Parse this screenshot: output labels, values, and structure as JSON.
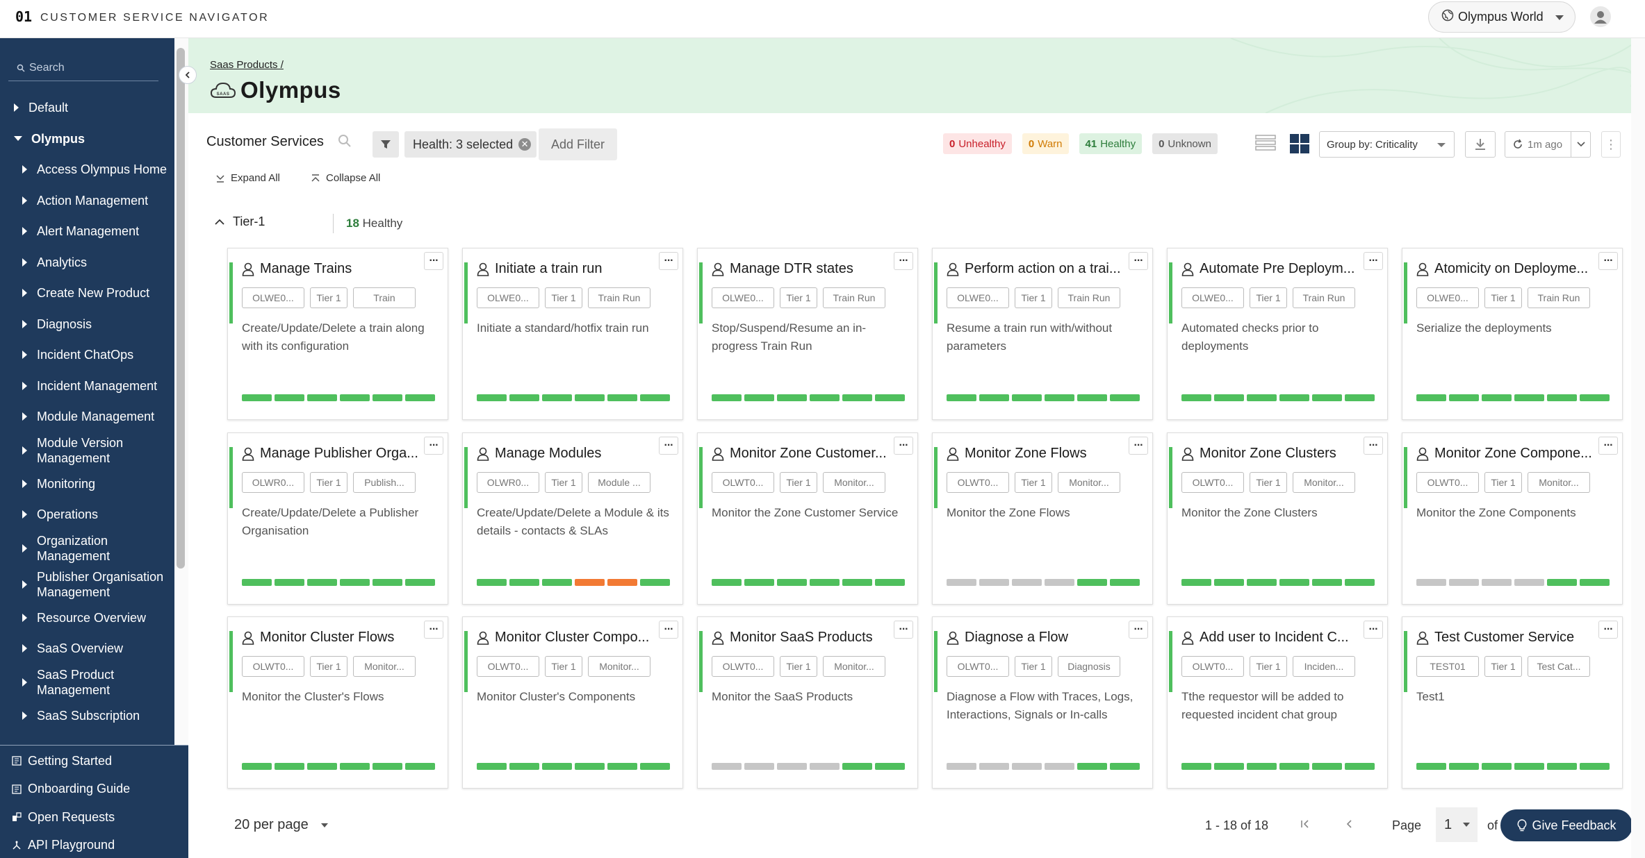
{
  "header": {
    "logo": "01",
    "app_title": "CUSTOMER SERVICE NAVIGATOR",
    "world_select": "Olympus World"
  },
  "sidebar": {
    "search_placeholder": "Search",
    "items": [
      {
        "label": "Default",
        "level": 0,
        "open": false
      },
      {
        "label": "Olympus",
        "level": 0,
        "open": true
      },
      {
        "label": "Access Olympus Home",
        "level": 1
      },
      {
        "label": "Action Management",
        "level": 1
      },
      {
        "label": "Alert Management",
        "level": 1
      },
      {
        "label": "Analytics",
        "level": 1
      },
      {
        "label": "Create New Product",
        "level": 1
      },
      {
        "label": "Diagnosis",
        "level": 1
      },
      {
        "label": "Incident ChatOps",
        "level": 1
      },
      {
        "label": "Incident Management",
        "level": 1
      },
      {
        "label": "Module Management",
        "level": 1
      },
      {
        "label": "Module Version Management",
        "level": 1
      },
      {
        "label": "Monitoring",
        "level": 1
      },
      {
        "label": "Operations",
        "level": 1
      },
      {
        "label": "Organization Management",
        "level": 1
      },
      {
        "label": "Publisher Organisation Management",
        "level": 1
      },
      {
        "label": "Resource Overview",
        "level": 1
      },
      {
        "label": "SaaS Overview",
        "level": 1
      },
      {
        "label": "SaaS Product Management",
        "level": 1
      },
      {
        "label": "SaaS Subscription",
        "level": 1
      }
    ],
    "bottom_links": [
      {
        "label": "Getting Started",
        "icon": "book-icon"
      },
      {
        "label": "Onboarding Guide",
        "icon": "book-icon"
      },
      {
        "label": "Open Requests",
        "icon": "requests-icon"
      },
      {
        "label": "API Playground",
        "icon": "playground-icon"
      }
    ]
  },
  "page": {
    "breadcrumb": "Saas Products /",
    "title": "Olympus",
    "cloud_icon_text": "SAAS"
  },
  "toolbar": {
    "label": "Customer Services",
    "health_filter": "Health: 3 selected",
    "add_filter": "Add Filter",
    "status": {
      "unhealthy_count": "0",
      "unhealthy_label": "Unhealthy",
      "warn_count": "0",
      "warn_label": "Warn",
      "healthy_count": "41",
      "healthy_label": "Healthy",
      "unknown_count": "0",
      "unknown_label": "Unknown"
    },
    "group_by": "Group by: Criticality",
    "refresh_ago": "1m ago",
    "expand_all": "Expand All",
    "collapse_all": "Collapse All"
  },
  "group": {
    "name": "Tier-1",
    "count": "18",
    "count_label": "Healthy"
  },
  "colors": {
    "sidebar": "#1f3a5c",
    "healthy": "#4fbf5d",
    "warn": "#f27a34",
    "unknown": "#c6c6c6",
    "banner": "#dff3e4"
  },
  "cards": [
    {
      "title": "Manage Trains",
      "tags": [
        "OLWE0...",
        "Tier 1",
        "Train"
      ],
      "desc": "Create/Update/Delete a train along with its configuration",
      "bars": [
        "g",
        "g",
        "g",
        "g",
        "g",
        "g"
      ]
    },
    {
      "title": "Initiate a train run",
      "tags": [
        "OLWE0...",
        "Tier 1",
        "Train Run"
      ],
      "desc": "Initiate a standard/hotfix train run",
      "bars": [
        "g",
        "g",
        "g",
        "g",
        "g",
        "g"
      ]
    },
    {
      "title": "Manage DTR states",
      "tags": [
        "OLWE0...",
        "Tier 1",
        "Train Run"
      ],
      "desc": "Stop/Suspend/Resume an in-progress Train Run",
      "bars": [
        "g",
        "g",
        "g",
        "g",
        "g",
        "g"
      ]
    },
    {
      "title": "Perform action on a trai...",
      "tags": [
        "OLWE0...",
        "Tier 1",
        "Train Run"
      ],
      "desc": "Resume a train run with/without parameters",
      "bars": [
        "g",
        "g",
        "g",
        "g",
        "g",
        "g"
      ]
    },
    {
      "title": "Automate Pre Deploym...",
      "tags": [
        "OLWE0...",
        "Tier 1",
        "Train Run"
      ],
      "desc": "Automated checks prior to deployments",
      "bars": [
        "g",
        "g",
        "g",
        "g",
        "g",
        "g"
      ]
    },
    {
      "title": "Atomicity on Deployme...",
      "tags": [
        "OLWE0...",
        "Tier 1",
        "Train Run"
      ],
      "desc": "Serialize the deployments",
      "bars": [
        "g",
        "g",
        "g",
        "g",
        "g",
        "g"
      ]
    },
    {
      "title": "Manage Publisher Orga...",
      "tags": [
        "OLWR0...",
        "Tier 1",
        "Publish..."
      ],
      "desc": "Create/Update/Delete a Publisher Organisation",
      "bars": [
        "g",
        "g",
        "g",
        "g",
        "g",
        "g"
      ]
    },
    {
      "title": "Manage Modules",
      "tags": [
        "OLWR0...",
        "Tier 1",
        "Module ..."
      ],
      "desc": "Create/Update/Delete a Module & its details - contacts & SLAs",
      "bars": [
        "g",
        "g",
        "g",
        "o",
        "o",
        "g"
      ]
    },
    {
      "title": "Monitor Zone Customer...",
      "tags": [
        "OLWT0...",
        "Tier 1",
        "Monitor..."
      ],
      "desc": "Monitor the Zone Customer Service",
      "bars": [
        "g",
        "g",
        "g",
        "g",
        "g",
        "g"
      ]
    },
    {
      "title": "Monitor Zone Flows",
      "tags": [
        "OLWT0...",
        "Tier 1",
        "Monitor..."
      ],
      "desc": "Monitor the Zone Flows",
      "bars": [
        "u",
        "u",
        "u",
        "u",
        "g",
        "g"
      ]
    },
    {
      "title": "Monitor Zone Clusters",
      "tags": [
        "OLWT0...",
        "Tier 1",
        "Monitor..."
      ],
      "desc": "Monitor the Zone Clusters",
      "bars": [
        "g",
        "g",
        "g",
        "g",
        "g",
        "g"
      ]
    },
    {
      "title": "Monitor Zone Compone...",
      "tags": [
        "OLWT0...",
        "Tier 1",
        "Monitor..."
      ],
      "desc": "Monitor the Zone Components",
      "bars": [
        "u",
        "u",
        "u",
        "u",
        "g",
        "g"
      ]
    },
    {
      "title": "Monitor Cluster Flows",
      "tags": [
        "OLWT0...",
        "Tier 1",
        "Monitor..."
      ],
      "desc": "Monitor the Cluster's Flows",
      "bars": [
        "g",
        "g",
        "g",
        "g",
        "g",
        "g"
      ]
    },
    {
      "title": "Monitor Cluster Compo...",
      "tags": [
        "OLWT0...",
        "Tier 1",
        "Monitor..."
      ],
      "desc": "Monitor Cluster's Components",
      "bars": [
        "g",
        "g",
        "g",
        "g",
        "g",
        "g"
      ]
    },
    {
      "title": "Monitor SaaS Products",
      "tags": [
        "OLWT0...",
        "Tier 1",
        "Monitor..."
      ],
      "desc": "Monitor the SaaS Products",
      "bars": [
        "u",
        "u",
        "u",
        "u",
        "g",
        "g"
      ]
    },
    {
      "title": "Diagnose a Flow",
      "tags": [
        "OLWT0...",
        "Tier 1",
        "Diagnosis"
      ],
      "desc": "Diagnose a Flow with Traces, Logs, Interactions, Signals or In-calls",
      "bars": [
        "u",
        "u",
        "u",
        "u",
        "g",
        "g"
      ]
    },
    {
      "title": "Add user to Incident C...",
      "tags": [
        "OLWT0...",
        "Tier 1",
        "Inciden..."
      ],
      "desc": "Tthe requestor will be added to requested incident chat group",
      "bars": [
        "g",
        "g",
        "g",
        "g",
        "g",
        "g"
      ]
    },
    {
      "title": "Test Customer Service",
      "tags": [
        "TEST01",
        "Tier 1",
        "Test Cat..."
      ],
      "desc": "Test1",
      "bars": [
        "g",
        "g",
        "g",
        "g",
        "g",
        "g"
      ]
    }
  ],
  "pagination": {
    "per_page": "20 per page",
    "range": "1 - 18 of 18",
    "page_label": "Page",
    "page_value": "1",
    "of_label": "of"
  },
  "feedback": "Give Feedback"
}
